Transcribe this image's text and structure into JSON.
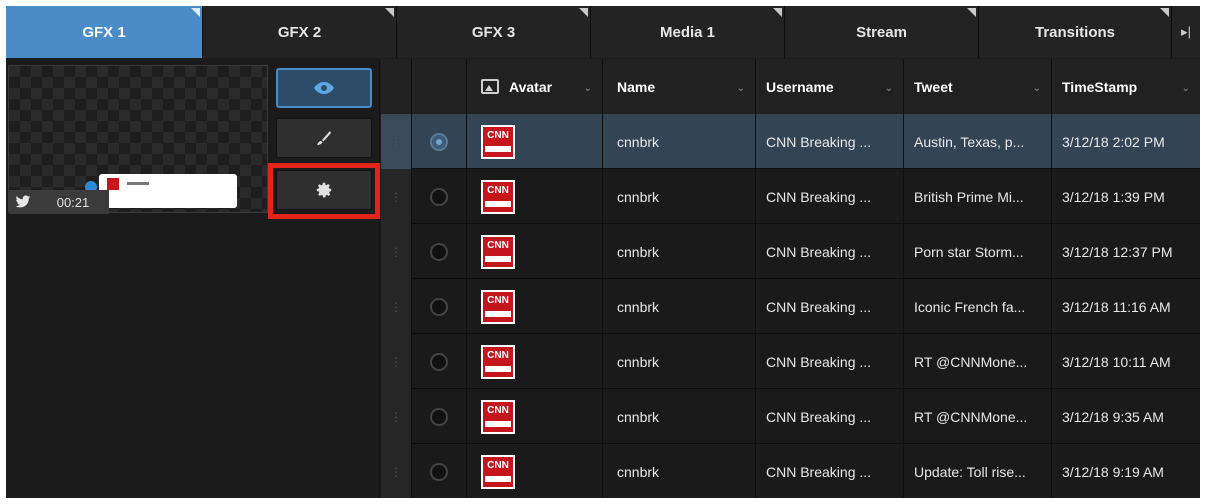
{
  "tabs": [
    {
      "label": "GFX 1",
      "active": true
    },
    {
      "label": "GFX 2",
      "active": false
    },
    {
      "label": "GFX 3",
      "active": false
    },
    {
      "label": "Media 1",
      "active": false
    },
    {
      "label": "Stream",
      "active": false
    },
    {
      "label": "Transitions",
      "active": false
    }
  ],
  "tab_more_icon": "▸|",
  "preview": {
    "timer": "00:21",
    "source_icon": "twitter-icon"
  },
  "side_buttons": [
    {
      "icon": "eye-icon",
      "active": true
    },
    {
      "icon": "brush-icon",
      "active": false
    },
    {
      "icon": "gear-icon",
      "active": false,
      "highlighted": true
    }
  ],
  "table": {
    "headers": {
      "avatar": "Avatar",
      "name": "Name",
      "username": "Username",
      "tweet": "Tweet",
      "timestamp": "TimeStamp"
    },
    "rows": [
      {
        "name": "cnnbrk",
        "username": "CNN Breaking ...",
        "tweet": "Austin, Texas, p...",
        "timestamp": "3/12/18 2:02 PM",
        "selected": true
      },
      {
        "name": "cnnbrk",
        "username": "CNN Breaking ...",
        "tweet": "British Prime Mi...",
        "timestamp": "3/12/18 1:39 PM",
        "selected": false
      },
      {
        "name": "cnnbrk",
        "username": "CNN Breaking ...",
        "tweet": "Porn star Storm...",
        "timestamp": "3/12/18 12:37 PM",
        "selected": false
      },
      {
        "name": "cnnbrk",
        "username": "CNN Breaking ...",
        "tweet": "Iconic French fa...",
        "timestamp": "3/12/18 11:16 AM",
        "selected": false
      },
      {
        "name": "cnnbrk",
        "username": "CNN Breaking ...",
        "tweet": "RT @CNNMone...",
        "timestamp": "3/12/18 10:11 AM",
        "selected": false
      },
      {
        "name": "cnnbrk",
        "username": "CNN Breaking ...",
        "tweet": "RT @CNNMone...",
        "timestamp": "3/12/18 9:35 AM",
        "selected": false
      },
      {
        "name": "cnnbrk",
        "username": "CNN Breaking ...",
        "tweet": "Update: Toll rise...",
        "timestamp": "3/12/18 9:19 AM",
        "selected": false
      }
    ],
    "avatar_logo_text": "CNN"
  },
  "colors": {
    "accent": "#4a8cc8",
    "selected_row": "#334454",
    "highlight_box": "#e3241b",
    "cnn_red": "#c4161c"
  }
}
